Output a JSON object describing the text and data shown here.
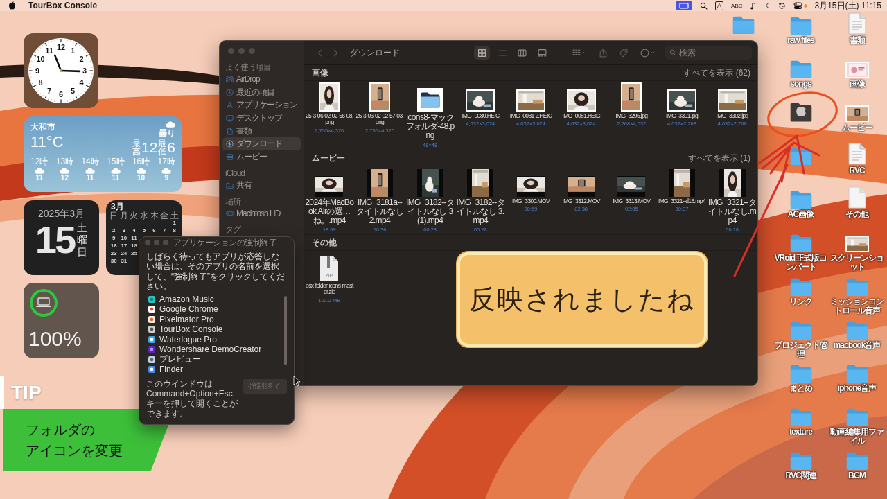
{
  "menu_bar": {
    "app_name": "TourBox Console",
    "input_source": "A",
    "input_mode": "ABC",
    "clock": "3月15日(土) 11:15"
  },
  "clock_widget": {
    "numerals": [
      "12",
      "11",
      "1",
      "10",
      "2",
      "9",
      "3",
      "8",
      "4",
      "7",
      "5",
      "6"
    ]
  },
  "weather_widget": {
    "city": "大和市",
    "temperature": "11°C",
    "condition": "曇り",
    "high_label": "最高",
    "high": "12",
    "low_label": "最低",
    "low": "6",
    "hourly": [
      {
        "time": "12時",
        "temp": "11"
      },
      {
        "time": "13時",
        "temp": "12"
      },
      {
        "time": "14時",
        "temp": "11"
      },
      {
        "time": "15時",
        "temp": "11"
      },
      {
        "time": "16時",
        "temp": "10"
      },
      {
        "time": "17時",
        "temp": "9"
      }
    ]
  },
  "date_widget": {
    "month": "2025年3月",
    "day": "15",
    "weekday": "土曜日"
  },
  "calendar_widget": {
    "month": "3月",
    "weekdays": [
      "日",
      "月",
      "火",
      "水",
      "木",
      "金",
      "土"
    ],
    "weeks": [
      [
        "1"
      ],
      [
        "2",
        "3",
        "4",
        "5",
        "6",
        "7",
        "8"
      ],
      [
        "9",
        "10",
        "11"
      ],
      [
        "16",
        "17",
        "18"
      ],
      [
        "23",
        "24",
        "25"
      ],
      [
        "30",
        "31"
      ]
    ]
  },
  "battery_widget": {
    "level": 1,
    "percent": "100%"
  },
  "desktop_left_column": [
    {
      "kind": "folder"
    }
  ],
  "desktop_icons": [
    {
      "kind": "folder",
      "label": "raw files"
    },
    {
      "kind": "text_document",
      "label": "書類"
    },
    {
      "kind": "folder",
      "label": "songs"
    },
    {
      "kind": "image_file",
      "label": "画像"
    },
    {
      "kind": "custom_folder"
    },
    {
      "kind": "image_file",
      "label": "ムービー"
    },
    {
      "kind": "folder"
    },
    {
      "kind": "text_document",
      "label": "RVC"
    },
    {
      "kind": "folder",
      "label": "AC画像"
    },
    {
      "kind": "blank_document",
      "label": "その他"
    },
    {
      "kind": "folder",
      "label": "VRoid 正式版コンバート"
    },
    {
      "kind": "image_file",
      "label": "スクリーンショット"
    },
    {
      "kind": "folder",
      "label": "リンク"
    },
    {
      "kind": "folder",
      "label": "ミッションコントロール音声"
    },
    {
      "kind": "folder",
      "label": "プロジェクト管理"
    },
    {
      "kind": "folder",
      "label": "macbook音声"
    },
    {
      "kind": "folder",
      "label": "まとめ"
    },
    {
      "kind": "folder",
      "label": "iphone音声"
    },
    {
      "kind": "folder",
      "label": "texture"
    },
    {
      "kind": "folder",
      "label": "動画編集用ファイル"
    },
    {
      "kind": "folder",
      "label": "RVC関連"
    },
    {
      "kind": "folder",
      "label": "BGM"
    }
  ],
  "finder": {
    "title": "ダウンロード",
    "nav_buttons": [
      {
        "disabled": true
      },
      {
        "disabled": true
      }
    ],
    "view_buttons": [
      {
        "selected": true
      },
      {
        "selected": false
      },
      {
        "selected": false
      },
      {
        "selected": false
      }
    ],
    "search": {
      "placeholder": "検索"
    },
    "sidebar": [
      {
        "header": "よく使う項目",
        "items": [
          {
            "label": "AirDrop",
            "selected": false
          },
          {
            "label": "最近の項目",
            "selected": false
          },
          {
            "label": "アプリケーション",
            "selected": false
          },
          {
            "label": "デスクトップ",
            "selected": false
          },
          {
            "label": "書類",
            "selected": false
          },
          {
            "label": "ダウンロード",
            "selected": true
          },
          {
            "label": "ムービー",
            "selected": false
          }
        ]
      },
      {
        "header": "iCloud",
        "items": [
          {
            "label": "共有",
            "selected": false
          }
        ]
      },
      {
        "header": "場所",
        "items": [
          {
            "label": "Macintosh HD",
            "selected": false
          }
        ]
      },
      {
        "header": "タグ"
      }
    ],
    "sections": [
      {
        "title": "画像",
        "show_all": "すべてを表示 (62)",
        "items": [
          {
            "kind": "portrait_photo",
            "name": "25-3-06-02-02-56-08.png",
            "detail": "2,755×4,320"
          },
          {
            "kind": "portrait_photo",
            "name": "25-3-06-02-02-57-03.png",
            "detail": "2,755×4,320"
          },
          {
            "kind": "icon_image",
            "name": "icons8-マックフォルダ-48.png",
            "detail": "48×48"
          },
          {
            "kind": "landscape_photo",
            "name": "IMG_0080.HEIC",
            "detail": "4,032×3,024"
          },
          {
            "kind": "landscape_photo",
            "name": "IMG_0081 2.HEIC",
            "detail": "4,032×3,024"
          },
          {
            "kind": "landscape_photo",
            "name": "IMG_0081.HEIC",
            "detail": "4,032×3,024"
          },
          {
            "kind": "portrait_photo",
            "name": "IMG_3295.jpg",
            "detail": "2,268×4,032"
          },
          {
            "kind": "landscape_photo",
            "name": "IMG_3301.jpg",
            "detail": "4,032×2,268"
          },
          {
            "kind": "landscape_photo",
            "name": "IMG_3302.jpg",
            "detail": "4,032×2,268"
          }
        ]
      },
      {
        "title": "ムービー",
        "show_all": "すべてを表示 (1)",
        "items": [
          {
            "kind": "landscape_video",
            "name": "2024年MacBook Airの選…ね。.mp4",
            "detail": "18:09"
          },
          {
            "kind": "portrait_video",
            "name": "IMG_3181a--タイトルなし 2.mp4",
            "detail": "00:36"
          },
          {
            "kind": "portrait_video",
            "name": "IMG_3182--タイトルなし 3 (1).mp4",
            "detail": "00:28"
          },
          {
            "kind": "portrait_video",
            "name": "IMG_3182--タイトルなし 3.mp4",
            "detail": "00:28"
          },
          {
            "kind": "landscape_video",
            "name": "IMG_3300.MOV",
            "detail": "00:59"
          },
          {
            "kind": "landscape_video",
            "name": "IMG_3312.MOV",
            "detail": "02:38"
          },
          {
            "kind": "landscape_video",
            "name": "IMG_3313.MOV",
            "detail": "02:05"
          },
          {
            "kind": "portrait_video",
            "name": "IMG_3321--d18.mp4",
            "detail": "00:07"
          },
          {
            "kind": "portrait_video",
            "name": "IMG_3321--タイトルなし.mp4",
            "detail": "00:18"
          }
        ]
      },
      {
        "title": "その他",
        "items": [
          {
            "kind": "archive",
            "icon_text": "ZIP",
            "name": "osx-folder-icons-master.zip",
            "detail": "102.2 MB"
          }
        ]
      }
    ]
  },
  "force_quit": {
    "title": "アプリケーションの強制終了",
    "message": "しばらく待ってもアプリが応答しない場合は、そのアプリの名前を選択して、“強制終了”をクリックしてください。",
    "apps": [
      {
        "name": "Amazon Music",
        "selected": false
      },
      {
        "name": "Google Chrome",
        "selected": false
      },
      {
        "name": "Pixelmator Pro",
        "selected": false
      },
      {
        "name": "TourBox Console",
        "selected": false
      },
      {
        "name": "Waterlogue Pro",
        "selected": false
      },
      {
        "name": "Wondershare DemoCreator",
        "selected": false
      },
      {
        "name": "プレビュー",
        "selected": false
      },
      {
        "name": "Finder",
        "selected": false
      }
    ],
    "note": "このウインドウはCommand+Option+Escキーを押して開くことができます。",
    "button": {
      "label": "強制終了",
      "disabled": true
    }
  },
  "callout": {
    "text": "反映されましたね"
  },
  "tip": {
    "badge": "TIP",
    "lines": [
      "フォルダの",
      "アイコンを変更"
    ]
  }
}
